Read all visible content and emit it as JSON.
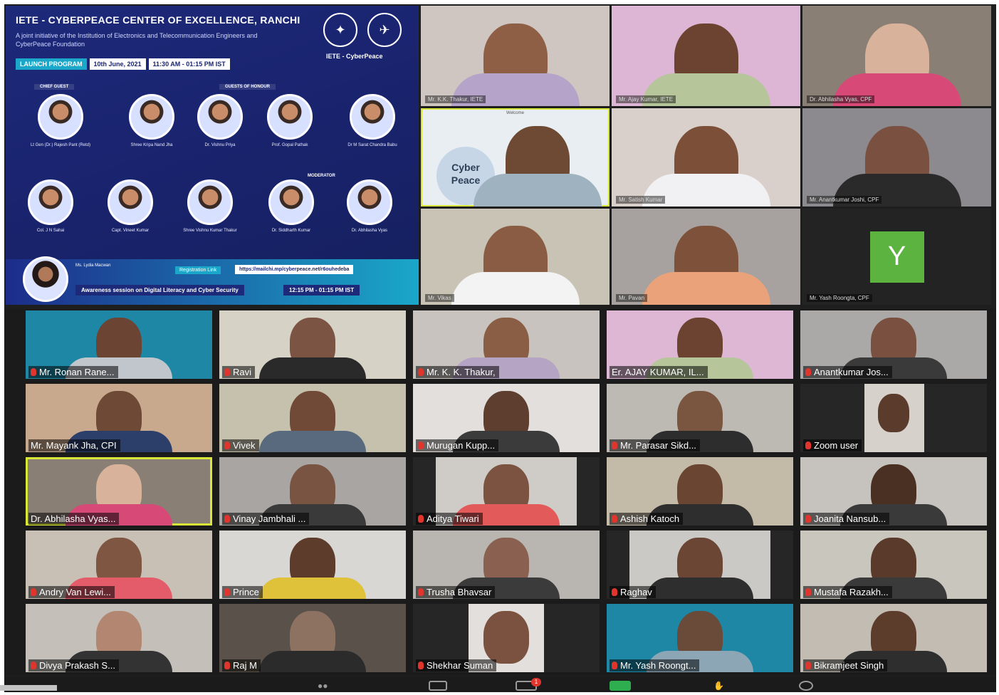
{
  "poster": {
    "title": "IETE - CYBERPEACE CENTER OF EXCELLENCE, RANCHI",
    "subtitle": "A joint initiative of the Institution of Electronics and Telecommunication Engineers and CyberPeace Foundation",
    "launch": "LAUNCH PROGRAM",
    "date": "10th June, 2021",
    "time": "11:30 AM - 01:15 PM IST",
    "logo_text": "IETE - CyberPeace",
    "chief_guest_label": "CHIEF GUEST",
    "guests_label": "GUESTS OF HONOUR",
    "moderator_label": "MODERATOR",
    "row1": [
      {
        "name": "Lt Gen (Dr.) Rajesh Pant (Retd)"
      },
      {
        "name": "Shree Kripa Nand Jha"
      },
      {
        "name": "Dr. Vishnu Priya"
      },
      {
        "name": "Prof. Gopal Pathak"
      },
      {
        "name": "Dr M Sarat Chandra Babu"
      }
    ],
    "row2": [
      {
        "name": "Col. J N Sahai"
      },
      {
        "name": "Capt. Vineet Kumar"
      },
      {
        "name": "Shree Vishnu Kumar Thakur"
      },
      {
        "name": "Dr. Siddharth Kumar"
      },
      {
        "name": "Dr. Abhilasha Vyas"
      }
    ],
    "host_name": "Ms. Lydia Macwan",
    "registration_label": "Registration Link",
    "registration_link": "https://mailchi.mp/cyberpeace.net/r6ouhedeba",
    "awareness": "Awareness session on Digital Literacy and Cyber Security",
    "awareness_time": "12:15 PM - 01:15 PM IST"
  },
  "top_tiles": [
    {
      "name": "Mr. K.K. Thakur, IETE"
    },
    {
      "name": "Mr. Ajay Kumar, IETE"
    },
    {
      "name": "Dr. Abhilasha Vyas, CPF"
    },
    {
      "name": "Cyber Peace",
      "caption": "Welcome"
    },
    {
      "name": "Mr. Satish Kumar"
    },
    {
      "name": "Mr. Anantkumar Joshi, CPF"
    },
    {
      "name": "Mr. Vikas"
    },
    {
      "name": "Mr. Pavan"
    },
    {
      "name": "Mr. Yash Roongta, CPF",
      "avatar": "Y"
    }
  ],
  "gallery": [
    {
      "name": "Mr. Ronan Rane..."
    },
    {
      "name": "Ravi"
    },
    {
      "name": "Mr. K. K. Thakur,"
    },
    {
      "name": "Er. AJAY KUMAR, IL..."
    },
    {
      "name": "Anantkumar Jos..."
    },
    {
      "name": "Mr. Mayank Jha, CPI"
    },
    {
      "name": "Vivek"
    },
    {
      "name": "Murugan Kupp..."
    },
    {
      "name": "Mr. Parasar Sikd..."
    },
    {
      "name": "Zoom user"
    },
    {
      "name": "Dr. Abhilasha Vyas..."
    },
    {
      "name": "Vinay Jambhali ..."
    },
    {
      "name": "Aditya Tiwari"
    },
    {
      "name": "Ashish Katoch"
    },
    {
      "name": "Joanita Nansub..."
    },
    {
      "name": "Andry Van Lewi..."
    },
    {
      "name": "Prince"
    },
    {
      "name": "Trusha Bhavsar"
    },
    {
      "name": "Raghav"
    },
    {
      "name": "Mustafa Razakh..."
    },
    {
      "name": "Divya Prakash S..."
    },
    {
      "name": "Raj M"
    },
    {
      "name": "Shekhar Suman"
    },
    {
      "name": "Mr. Yash Roongt..."
    },
    {
      "name": "Bikramjeet Singh"
    }
  ],
  "toolbar": {
    "chat_badge": "1"
  },
  "colors": {
    "poster_bg": "#1d2a7a",
    "accent_cyan": "#1aa7c9",
    "active_speaker": "#d8e63a",
    "mic_muted": "#e0352d",
    "avatar_y": "#5db33f"
  }
}
